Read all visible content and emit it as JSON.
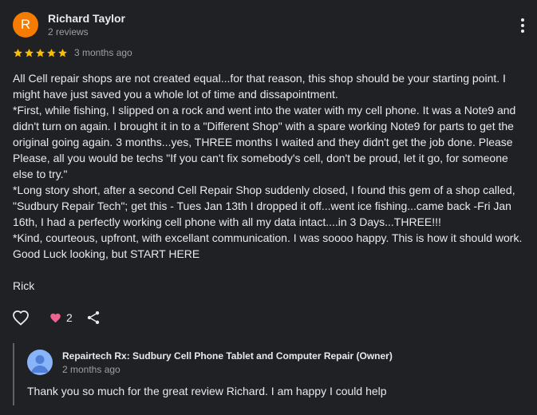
{
  "review": {
    "avatar_initial": "R",
    "avatar_color": "#f57c00",
    "author_name": "Richard Taylor",
    "author_meta": "2 reviews",
    "rating": 5,
    "star_color": "#fbbc04",
    "time": "3 months ago",
    "text": "All Cell repair shops are not created equal...for that reason, this shop should be your starting point. I might have just saved you a whole lot of time and dissapointment.\n*First, while fishing, I slipped on a rock and went into the water with my cell phone. It was a Note9 and didn't turn on again. I brought it in to a \"Different Shop\" with a spare working Note9 for parts to get the original going again. 3 months...yes, THREE months I waited and they didn't get the job done. Please Please, all you would be techs \"If you can't fix somebody's cell, don't be proud, let it go, for someone else to try.\"\n*Long story short, after a second Cell Repair Shop suddenly closed, I found this gem of a shop called, \"Sudbury Repair Tech\"; get this - Tues Jan 13th I dropped it off...went ice fishing...came back -Fri Jan 16th, I had a perfectly working cell phone with all my data intact....in 3 Days...THREE!!!\n*Kind, courteous, upfront, with excellant communication. I was soooo happy. This is how it should work. Good Luck looking, but START HERE\n\nRick",
    "reaction_count": "2",
    "icons": {
      "more": "more-vert-icon",
      "like": "heart-outline-icon",
      "reaction": "heart-filled-icon",
      "share": "share-icon"
    },
    "reaction_color": "#f06292"
  },
  "owner_reply": {
    "name": "Repairtech Rx: Sudbury Cell Phone Tablet and Computer Repair (Owner)",
    "time": "2 months ago",
    "text": "Thank you so much for the great review Richard. I am happy I could help",
    "avatar_icon": "person-avatar-icon",
    "avatar_color": "#8ab4f8"
  }
}
